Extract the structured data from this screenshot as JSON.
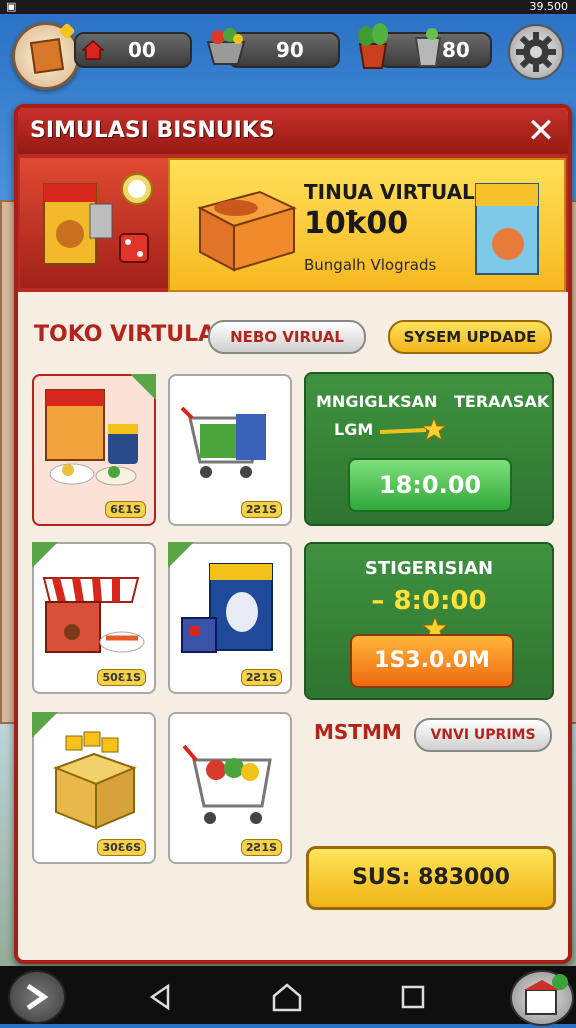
{
  "status_bar": {
    "right_text": "39.500"
  },
  "resources": [
    {
      "icon": "house-icon",
      "value": "00"
    },
    {
      "icon": "basket-icon",
      "value": "90"
    },
    {
      "icon": "plant-icon",
      "value": "80"
    }
  ],
  "panel": {
    "title": "SIMULASI BISNUIKS",
    "banner": {
      "title": "TINUA VIRTUAL",
      "value": "10ꝁ00",
      "subtitle": "Bungalh Vlograds"
    },
    "section_title": "TOKO VIRTULA",
    "tab_grey": "NEBO VIRUAL",
    "tab_yellow": "SYSEM UPDADE",
    "cards": [
      {
        "name": "food-package",
        "badge": "6Ɛ1S"
      },
      {
        "name": "shopping-cart",
        "badge": "2Ƨ1S"
      },
      {
        "name": "market-stall",
        "badge": "50Ɛ1S"
      },
      {
        "name": "product-box",
        "badge": "2Ƨ1S"
      },
      {
        "name": "gold-crate",
        "badge": "30Ɛ6S"
      },
      {
        "name": "grocery-cart",
        "badge": "2Ƨ1S"
      }
    ],
    "box1": {
      "line1_left": "MNGIGLKSAN",
      "line1_right": "TERAɅSAK",
      "line2": "LGM",
      "button": "18:0.00"
    },
    "box2": {
      "title": "STIGERISIAN",
      "value": "– 8:0:00",
      "button": "1S3.0.0M"
    },
    "side_label": "MSTMM",
    "side_button": "VNVI UPRIMS",
    "bottom_button": "SUS: 883000"
  },
  "colors": {
    "primary_red": "#b3251c",
    "gold": "#f2b418",
    "green": "#2f7430"
  }
}
